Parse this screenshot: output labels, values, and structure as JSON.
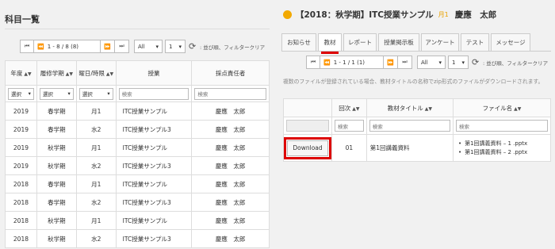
{
  "left": {
    "title": "科目一覧",
    "pager": {
      "first": "⏮",
      "prev": "⏪",
      "info": "1 - 8 / 8 (8)",
      "next": "⏩",
      "last": "⏭",
      "filter_select": "All",
      "page_select": "1",
      "note": ": 並び順、フィルタークリア"
    },
    "columns": [
      "年度",
      "履修学期",
      "曜日/時限",
      "授業",
      "採点責任者"
    ],
    "filters": {
      "year": "選択",
      "term": "選択",
      "day": "選択",
      "course_placeholder": "検索",
      "teacher_placeholder": "検索"
    },
    "rows": [
      {
        "year": "2019",
        "term": "春学期",
        "day": "月1",
        "course": "ITC授業サンプル",
        "teacher": "慶應　太郎"
      },
      {
        "year": "2019",
        "term": "春学期",
        "day": "水2",
        "course": "ITC授業サンプル3",
        "teacher": "慶應　太郎"
      },
      {
        "year": "2019",
        "term": "秋学期",
        "day": "月1",
        "course": "ITC授業サンプル",
        "teacher": "慶應　太郎"
      },
      {
        "year": "2019",
        "term": "秋学期",
        "day": "水2",
        "course": "ITC授業サンプル3",
        "teacher": "慶應　太郎"
      },
      {
        "year": "2018",
        "term": "春学期",
        "day": "月1",
        "course": "ITC授業サンプル",
        "teacher": "慶應　太郎"
      },
      {
        "year": "2018",
        "term": "春学期",
        "day": "水2",
        "course": "ITC授業サンプル3",
        "teacher": "慶應　太郎"
      },
      {
        "year": "2018",
        "term": "秋学期",
        "day": "月1",
        "course": "ITC授業サンプル",
        "teacher": "慶應　太郎"
      },
      {
        "year": "2018",
        "term": "秋学期",
        "day": "水2",
        "course": "ITC授業サンプル3",
        "teacher": "慶應　太郎"
      }
    ]
  },
  "right": {
    "course_title": "【2018：秋学期】ITC授業サンプル",
    "time": "月1",
    "teacher": "慶應　太郎",
    "tabs": [
      "お知らせ",
      "教材",
      "レポート",
      "授業掲示板",
      "アンケート",
      "テスト",
      "メッセージ"
    ],
    "active_tab": "教材",
    "pager": {
      "first": "⏮",
      "prev": "⏪",
      "info": "1 - 1 / 1 (1)",
      "next": "⏩",
      "last": "⏭",
      "filter_select": "All",
      "page_select": "1",
      "note": ": 並び順、フィルタークリア"
    },
    "note": "複数のファイルが登録されている場合、教材タイトルの名称でzip形式のファイルがダウンロードされます。",
    "columns": [
      "",
      "回次",
      "教材タイトル",
      "ファイル名"
    ],
    "filter_placeholder": "検索",
    "row": {
      "download_label": "Download",
      "number": "01",
      "title": "第1回講義資料",
      "files": [
        "第1回講義資料 – 1 .pptx",
        "第1回講義資料 – 2 .pptx"
      ]
    }
  },
  "colors": {
    "accent_red": "#dd0000",
    "orange": "#f2a900",
    "link_blue": "#1a5fa8"
  }
}
